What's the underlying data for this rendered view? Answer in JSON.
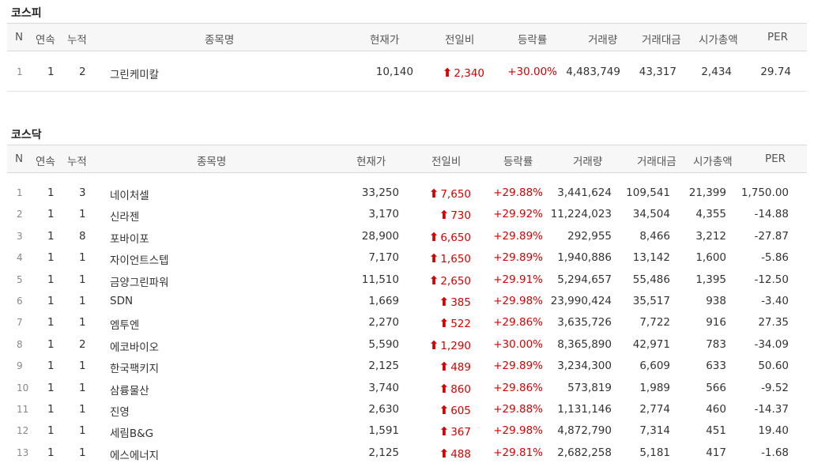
{
  "columns": {
    "n": "N",
    "consecutive": "연속",
    "cumulative": "누적",
    "name": "종목명",
    "price": "현재가",
    "change": "전일비",
    "rate": "등락률",
    "volume": "거래량",
    "amount": "거래대금",
    "market_cap": "시가총액",
    "per": "PER"
  },
  "colors": {
    "up": "#d60000"
  },
  "icons": {
    "up_arrow": "up-arrow-icon"
  },
  "kospi": {
    "title": "코스피",
    "rows": [
      {
        "n": "1",
        "cons": "1",
        "cum": "2",
        "name": "그린케미칼",
        "price": "10,140",
        "change": "2,340",
        "rate": "+30.00%",
        "volume": "4,483,749",
        "amount": "43,317",
        "cap": "2,434",
        "per": "29.74"
      }
    ]
  },
  "kosdaq": {
    "title": "코스닥",
    "rows": [
      {
        "n": "1",
        "cons": "1",
        "cum": "3",
        "name": "네이처셀",
        "price": "33,250",
        "change": "7,650",
        "rate": "+29.88%",
        "volume": "3,441,624",
        "amount": "109,541",
        "cap": "21,399",
        "per": "1,750.00"
      },
      {
        "n": "2",
        "cons": "1",
        "cum": "1",
        "name": "신라젠",
        "price": "3,170",
        "change": "730",
        "rate": "+29.92%",
        "volume": "11,224,023",
        "amount": "34,504",
        "cap": "4,355",
        "per": "-14.88"
      },
      {
        "n": "3",
        "cons": "1",
        "cum": "8",
        "name": "포바이포",
        "price": "28,900",
        "change": "6,650",
        "rate": "+29.89%",
        "volume": "292,955",
        "amount": "8,466",
        "cap": "3,212",
        "per": "-27.87"
      },
      {
        "n": "4",
        "cons": "1",
        "cum": "1",
        "name": "자이언트스텝",
        "price": "7,170",
        "change": "1,650",
        "rate": "+29.89%",
        "volume": "1,940,886",
        "amount": "13,142",
        "cap": "1,600",
        "per": "-5.86"
      },
      {
        "n": "5",
        "cons": "1",
        "cum": "1",
        "name": "금양그린파워",
        "price": "11,510",
        "change": "2,650",
        "rate": "+29.91%",
        "volume": "5,294,657",
        "amount": "55,486",
        "cap": "1,395",
        "per": "-12.50"
      },
      {
        "n": "6",
        "cons": "1",
        "cum": "1",
        "name": "SDN",
        "price": "1,669",
        "change": "385",
        "rate": "+29.98%",
        "volume": "23,990,424",
        "amount": "35,517",
        "cap": "938",
        "per": "-3.40"
      },
      {
        "n": "7",
        "cons": "1",
        "cum": "1",
        "name": "엠투엔",
        "price": "2,270",
        "change": "522",
        "rate": "+29.86%",
        "volume": "3,635,726",
        "amount": "7,722",
        "cap": "916",
        "per": "27.35"
      },
      {
        "n": "8",
        "cons": "1",
        "cum": "2",
        "name": "에코바이오",
        "price": "5,590",
        "change": "1,290",
        "rate": "+30.00%",
        "volume": "8,365,890",
        "amount": "42,971",
        "cap": "783",
        "per": "-34.09"
      },
      {
        "n": "9",
        "cons": "1",
        "cum": "1",
        "name": "한국팩키지",
        "price": "2,125",
        "change": "489",
        "rate": "+29.89%",
        "volume": "3,234,300",
        "amount": "6,609",
        "cap": "633",
        "per": "50.60"
      },
      {
        "n": "10",
        "cons": "1",
        "cum": "1",
        "name": "삼륭물산",
        "price": "3,740",
        "change": "860",
        "rate": "+29.86%",
        "volume": "573,819",
        "amount": "1,989",
        "cap": "566",
        "per": "-9.52"
      },
      {
        "n": "11",
        "cons": "1",
        "cum": "1",
        "name": "진영",
        "price": "2,630",
        "change": "605",
        "rate": "+29.88%",
        "volume": "1,131,146",
        "amount": "2,774",
        "cap": "460",
        "per": "-14.37"
      },
      {
        "n": "12",
        "cons": "1",
        "cum": "1",
        "name": "세림B&G",
        "price": "1,591",
        "change": "367",
        "rate": "+29.98%",
        "volume": "4,872,790",
        "amount": "7,314",
        "cap": "451",
        "per": "19.40"
      },
      {
        "n": "13",
        "cons": "1",
        "cum": "1",
        "name": "에스에너지",
        "price": "2,125",
        "change": "488",
        "rate": "+29.81%",
        "volume": "2,682,258",
        "amount": "5,181",
        "cap": "417",
        "per": "-1.68"
      }
    ]
  }
}
